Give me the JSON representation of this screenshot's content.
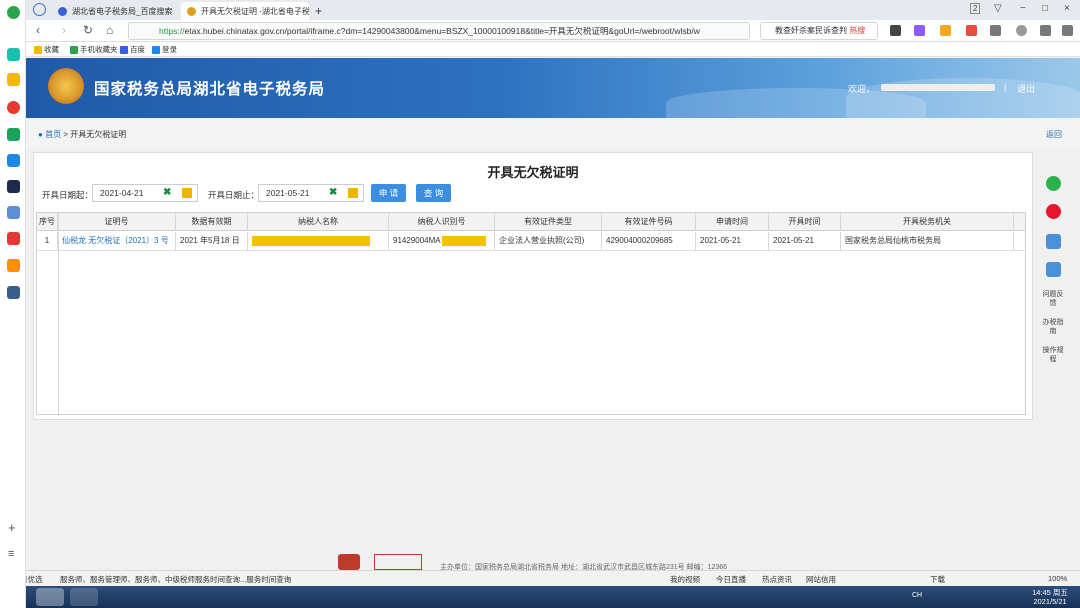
{
  "browser": {
    "tabs": [
      {
        "label": "湖北省电子税务局_百度搜索",
        "close": ""
      },
      {
        "label": "开具无欠税证明 -湖北省电子税...",
        "close": "×"
      }
    ],
    "new_tab": "+",
    "window_controls": {
      "num": "2",
      "min": "−",
      "max": "□",
      "close": "×"
    },
    "url_https": "https://",
    "url_rest": "etax.hubei.chinatax.gov.cn/portal/iframe.c?dm=14290043800&menu=BSZX_10000100918&title=开具无欠税证明&goUrl=/webroot/wlsb/w",
    "search_text": "教查奸杀案民诉查判",
    "search_hot": "热搜",
    "bookmarks": [
      "收藏",
      "手机收藏夹",
      "百度",
      "登录"
    ]
  },
  "page": {
    "site_title": "国家税务总局湖北省电子税务局",
    "welcome": "欢迎，",
    "separator": "|",
    "logout": "退出",
    "breadcrumb_home": "首页",
    "breadcrumb_sep": ">",
    "breadcrumb_current": "开具无欠税证明",
    "back": "返回",
    "form_title": "开具无欠税证明",
    "date_start_label": "开具日期起：",
    "date_start_value": "2021-04-21",
    "date_end_label": "开具日期止：",
    "date_end_value": "2021-05-21",
    "clear_glyph": "✖",
    "apply_button": "申 请",
    "query_button": "查 询"
  },
  "table": {
    "headers": [
      "序号",
      "证明号",
      "数据有效期",
      "纳税人名称",
      "纳税人识别号",
      "有效证件类型",
      "有效证件号码",
      "申请时间",
      "开具时间",
      "开具税务机关"
    ],
    "rows": [
      {
        "index": "1",
        "cert_no": "仙税龙 无欠税证〔2021〕3 号",
        "validity": "2021 年5月18 日",
        "taxpayer_name": "",
        "taxpayer_id": "91429004MA",
        "doc_type": "企业法人营业执照(公司)",
        "doc_no": "429004000209685",
        "apply_time": "2021-05-21",
        "issue_time": "2021-05-21",
        "authority": "国家税务总局仙桃市税务局"
      }
    ]
  },
  "right_toolbar": {
    "items": [
      "问题反馈",
      "办税指南",
      "操作规程"
    ]
  },
  "footer": {
    "text": "主办单位：国家税务总局湖北省税务局 地址：湖北省武汉市武昌区城东路231号 邮编：12366"
  },
  "statusbar": {
    "left_item": "今日优选",
    "news": "服务师、服务管理师、服务师、中级税师服务时间查询...服务时间查询",
    "right_items": [
      "我的视频",
      "今日直播",
      "热点资讯",
      "网站信用"
    ],
    "download": "下载",
    "zoom": "100%"
  },
  "taskbar": {
    "time": "14:45 周五",
    "date": "2021/5/21",
    "tray": "CH"
  },
  "colors": {
    "banner": "#2d72bf",
    "accent": "#3d8ee0",
    "highlight": "#f2c200"
  }
}
